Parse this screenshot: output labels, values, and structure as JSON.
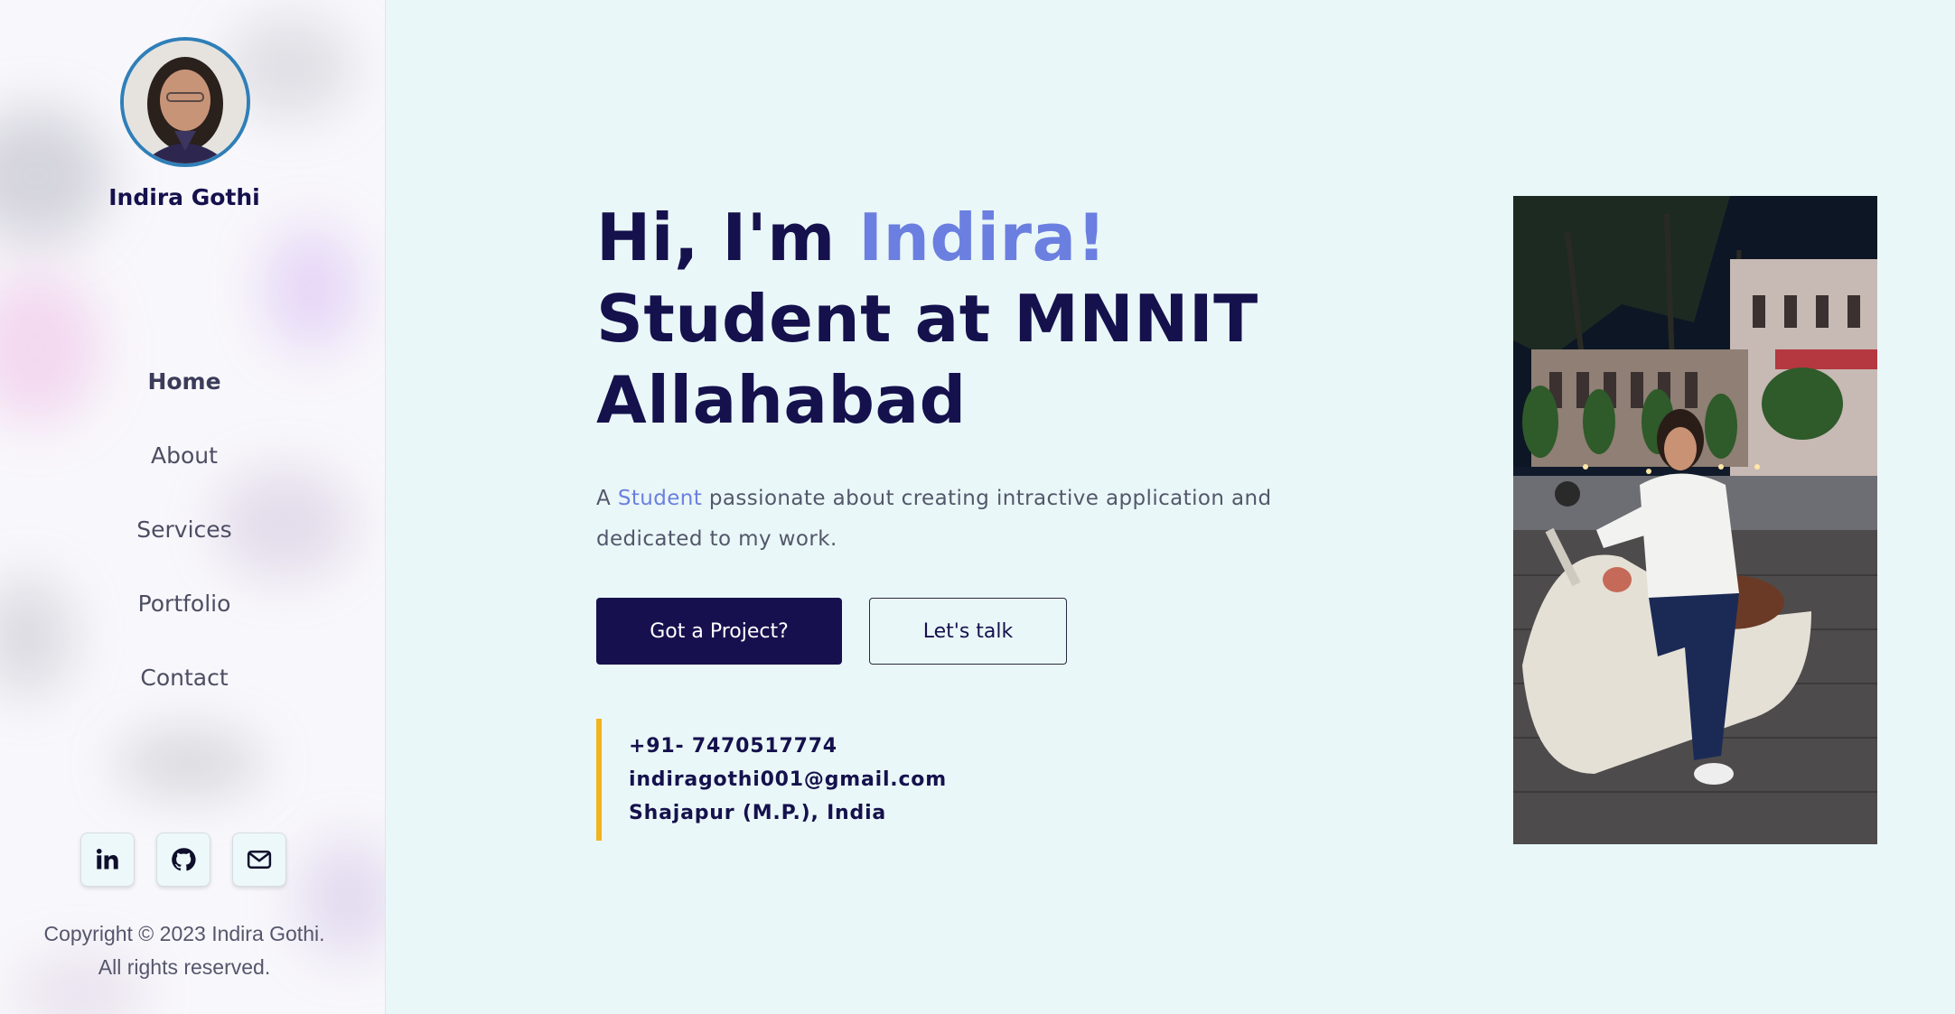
{
  "sidebar": {
    "name": "Indira Gothi",
    "nav": [
      "Home",
      "About",
      "Services",
      "Portfolio",
      "Contact"
    ],
    "active_nav": "Home",
    "socials": [
      {
        "icon": "linkedin-icon"
      },
      {
        "icon": "github-icon"
      },
      {
        "icon": "mail-icon"
      }
    ],
    "copyright_line1": "Copyright © 2023 Indira Gothi.",
    "copyright_line2": "All rights reserved."
  },
  "hero": {
    "greeting": "Hi, I'm ",
    "name_accent": "Indira!",
    "line2": "Student at MNNIT",
    "line3": "Allahabad",
    "desc_prefix": "A ",
    "desc_accent": "Student",
    "desc_rest": " passionate about creating intractive application and dedicated to my work.",
    "primary_button": "Got a Project?",
    "secondary_button": "Let's talk"
  },
  "contact": {
    "phone": "+91- 7470517774",
    "email": "indiragothi001@gmail.com",
    "location": "Shajapur (M.P.), India"
  },
  "colors": {
    "navy": "#15114d",
    "accent": "#6b7fe0",
    "contact_bar": "#f2b320",
    "page_bg": "#eaf7f8",
    "avatar_ring": "#2f7fb8"
  }
}
